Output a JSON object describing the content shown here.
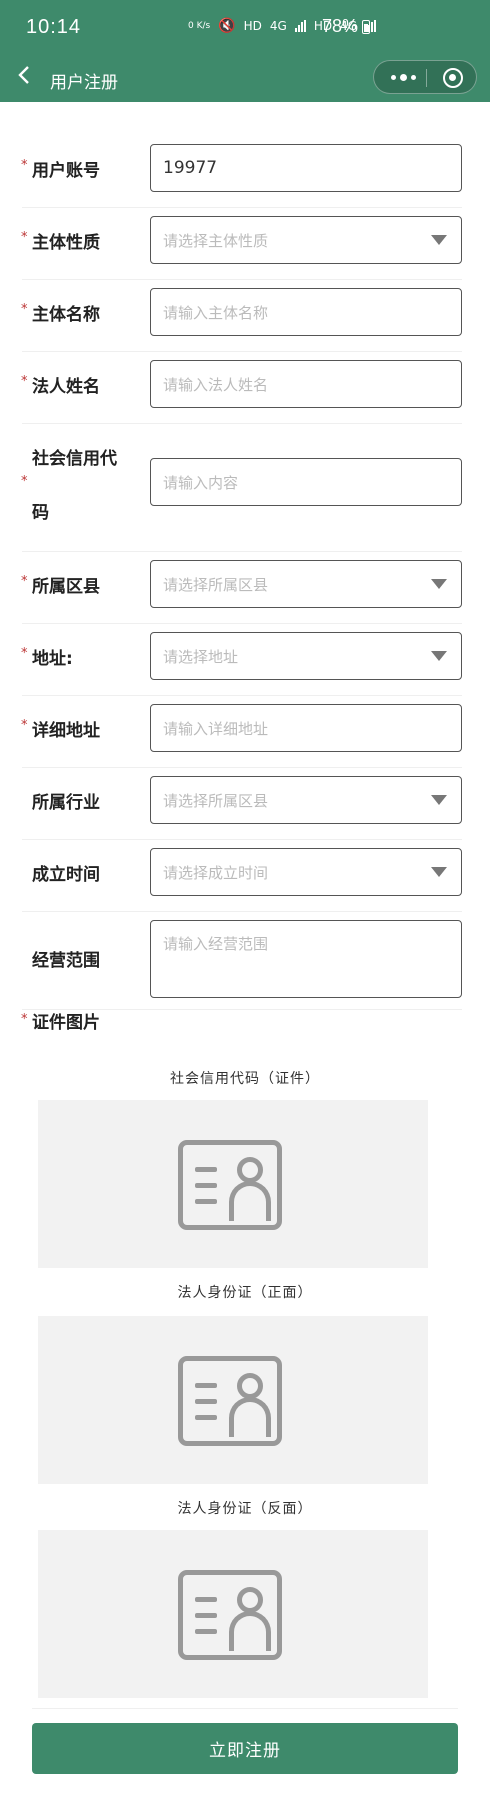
{
  "status_bar": {
    "time": "10:14",
    "net_speed": "0 K/s",
    "hd1": "HD",
    "net1": "4G",
    "hd2": "HD",
    "net2": "4G",
    "battery": "78%"
  },
  "nav": {
    "title": "用户注册"
  },
  "colors": {
    "primary": "#3e8a6b",
    "required_star": "#b33333",
    "placeholder": "#bbbbbb"
  },
  "form": {
    "account": {
      "label": "用户账号",
      "value": "19977"
    },
    "entity_type": {
      "label": "主体性质",
      "placeholder": "请选择主体性质"
    },
    "entity_name": {
      "label": "主体名称",
      "placeholder": "请输入主体名称"
    },
    "legal_person": {
      "label": "法人姓名",
      "placeholder": "请输入法人姓名"
    },
    "credit_code": {
      "label_line1": "社会信用代",
      "label_line2": "码",
      "placeholder": "请输入内容"
    },
    "county": {
      "label": "所属区县",
      "placeholder": "请选择所属区县"
    },
    "address": {
      "label": "地址:",
      "placeholder": "请选择地址"
    },
    "detail_address": {
      "label": "详细地址",
      "placeholder": "请输入详细地址"
    },
    "industry": {
      "label": "所属行业",
      "placeholder": "请选择所属区县"
    },
    "founded": {
      "label": "成立时间",
      "placeholder": "请选择成立时间"
    },
    "scope": {
      "label": "经营范围",
      "placeholder": "请输入经营范围"
    },
    "required_mark": "*"
  },
  "images": {
    "title": "证件图片",
    "items": [
      {
        "caption": "社会信用代码（证件）",
        "icon": "id-card-icon"
      },
      {
        "caption": "法人身份证（正面）",
        "icon": "id-card-icon"
      },
      {
        "caption": "法人身份证（反面）",
        "icon": "id-card-icon"
      }
    ]
  },
  "submit_label": "立即注册"
}
